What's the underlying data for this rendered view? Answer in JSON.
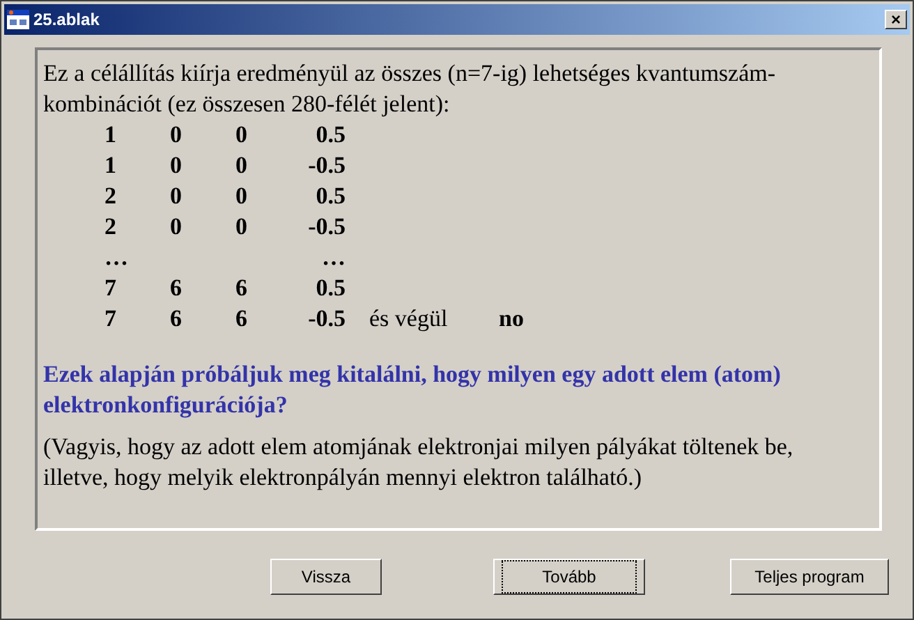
{
  "window": {
    "title": "25.ablak",
    "close": "×"
  },
  "intro": "Ez a célállítás kiírja eredményül az összes (n=7-ig) lehetséges kvantumszám-kombinációt (ez összesen 280-félét jelent):",
  "rows": [
    {
      "n": "1",
      "l": "0",
      "ml": "0",
      "ms": "0.5"
    },
    {
      "n": "1",
      "l": "0",
      "ml": "0",
      "ms": "-0.5"
    },
    {
      "n": "2",
      "l": "0",
      "ml": "0",
      "ms": "0.5"
    },
    {
      "n": "2",
      "l": "0",
      "ml": "0",
      "ms": "-0.5"
    },
    {
      "n": "…",
      "ms": "…"
    },
    {
      "n": "7",
      "l": "6",
      "ml": "6",
      "ms": "0.5"
    },
    {
      "n": "7",
      "l": "6",
      "ml": "6",
      "ms": "-0.5",
      "note": "és végül",
      "final": "no"
    }
  ],
  "question": "Ezek alapján próbáljuk meg kitalálni, hogy milyen egy adott elem (atom) elektronkonfigurációja?",
  "explanation": "(Vagyis, hogy az adott elem atomjának elektronjai milyen pályákat töltenek be, illetve, hogy melyik elektronpályán mennyi elektron található.)",
  "buttons": [
    {
      "label": "Vissza",
      "focused": false
    },
    {
      "label": "Tovább",
      "focused": true
    },
    {
      "label": "Teljes program",
      "focused": false
    }
  ]
}
